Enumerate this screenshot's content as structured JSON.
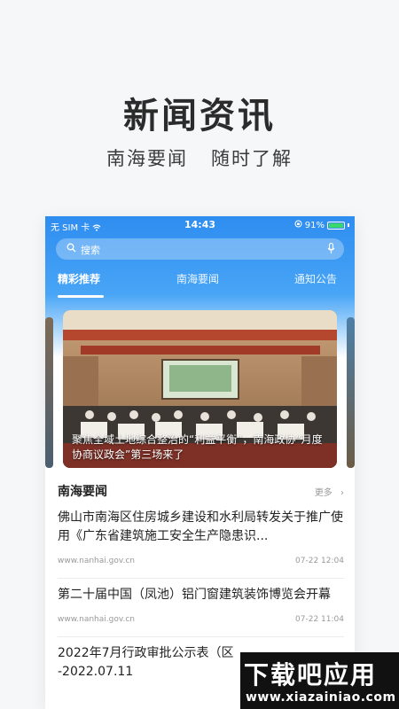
{
  "promo": {
    "title": "新闻资讯",
    "subtitle": "南海要闻   随时了解"
  },
  "status_bar": {
    "carrier": "无 SIM 卡",
    "time": "14:43",
    "battery": "91%"
  },
  "search": {
    "placeholder": "搜索"
  },
  "tabs": [
    {
      "label": "精彩推荐",
      "active": true
    },
    {
      "label": "南海要闻",
      "active": false
    },
    {
      "label": "通知公告",
      "active": false
    }
  ],
  "banner": {
    "caption": "聚焦全域土地综合整治的“利益平衡”，南海政协“月度协商议政会”第三场来了"
  },
  "section": {
    "title": "南海要闻",
    "more_label": "更多"
  },
  "news": [
    {
      "title": "佛山市南海区住房城乡建设和水利局转发关于推广使用《广东省建筑施工安全生产隐患识...",
      "source": "www.nanhai.gov.cn",
      "time": "07-22 12:04"
    },
    {
      "title": "第二十届中国（凤池）铝门窗建筑装饰博览会开幕",
      "source": "www.nanhai.gov.cn",
      "time": "07-22 11:04"
    },
    {
      "title": "2022年7月行政审批公示表（区",
      "title_line2": "-2022.07.11"
    }
  ],
  "watermark": {
    "main": "下载吧应用",
    "url": "www.xiazainiao.com"
  }
}
